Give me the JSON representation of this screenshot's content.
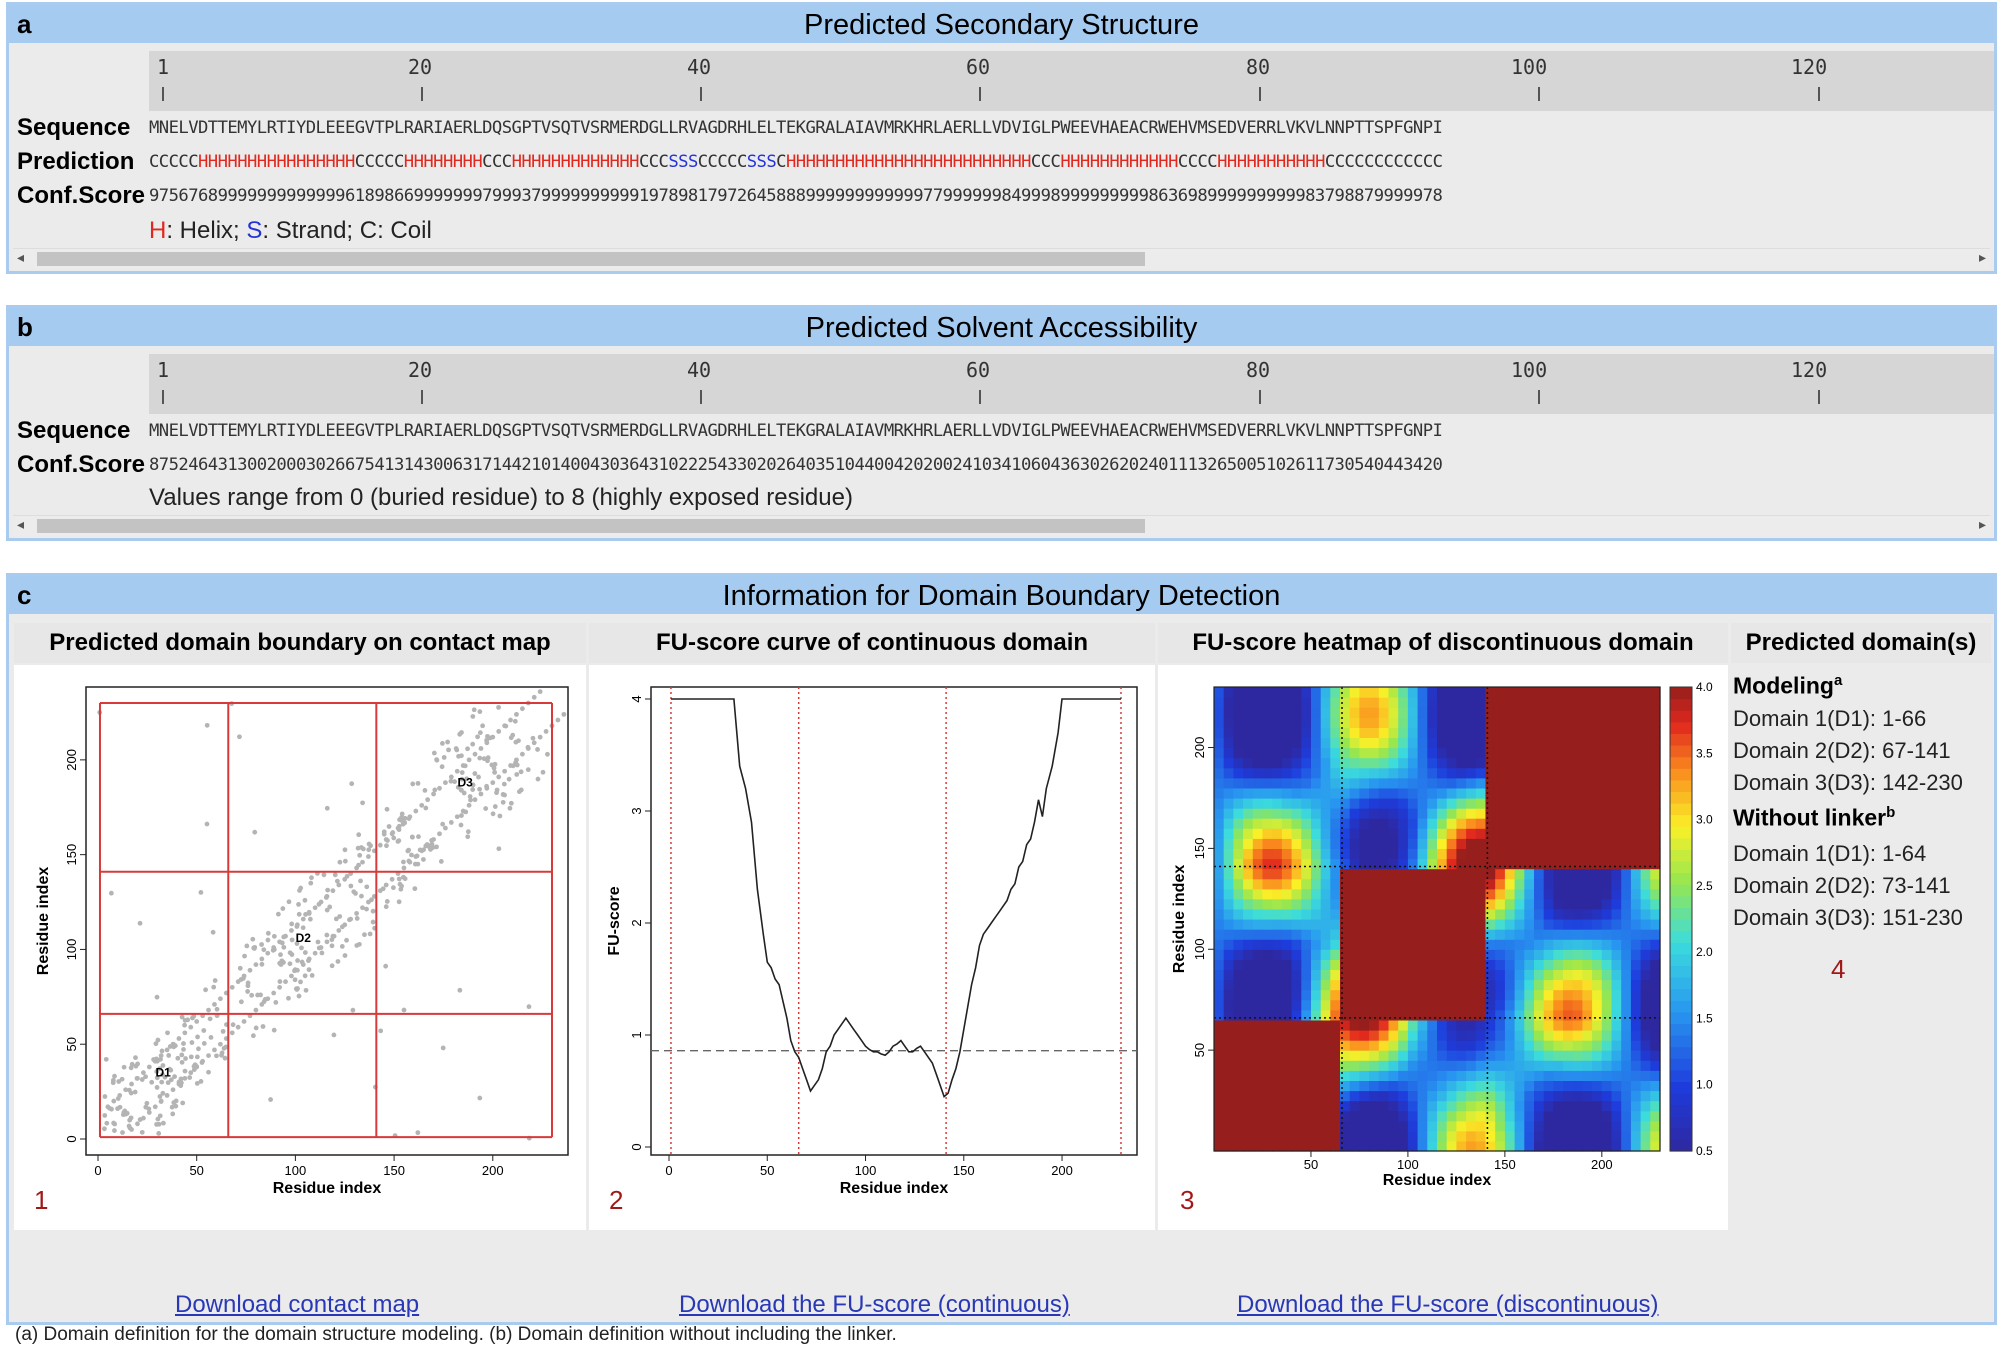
{
  "panel_a": {
    "letter": "a",
    "title": "Predicted Secondary Structure",
    "ticks": [
      "1",
      "20",
      "40",
      "60",
      "80",
      "100",
      "120"
    ],
    "sequence_label": "Sequence",
    "prediction_label": "Prediction",
    "conf_label": "Conf.Score",
    "sequence": "MNELVDTTEMYLRTIYDLEEEGVTPLRARIAERLDQSGPTVSQTVSRMERDGLLRVAGDRHLELTEKGRALAIAVMRKHRLAERLLVDVIGLPWEEVHAEACRWEHVMSEDVERRLVKVLNNPTTSPFGNPI",
    "prediction": "CCCCCHHHHHHHHHHHHHHHHCCCCCHHHHHHHHCCCHHHHHHHHHHHHHCCCSSSCCCCCSSSCHHHHHHHHHHHHHHHHHHHHHHHHHCCCHHHHHHHHHHHHCCCCHHHHHHHHHHHCCCCCCCCCCCC",
    "conf": "975676899999999999996189866999999979993799999999991978981797264588899999999999977999999849998999999999863698999999999983798879999978",
    "legend_h": "H",
    "legend_h_text": ": Helix; ",
    "legend_s": "S",
    "legend_s_text": ": Strand; C: Coil"
  },
  "panel_b": {
    "letter": "b",
    "title": "Predicted Solvent Accessibility",
    "ticks": [
      "1",
      "20",
      "40",
      "60",
      "80",
      "100",
      "120"
    ],
    "sequence_label": "Sequence",
    "conf_label": "Conf.Score",
    "sequence": "MNELVDTTEMYLRTIYDLEEEGVTPLRARIAERLDQSGPTVSQTVSRMERDGLLRVAGDRHLELTEKGRALAIAVMRKHRLAERLLVDVIGLPWEEVHAEACRWEHVMSEDVERRLVKVLNNPTTSPFGNPI",
    "conf": "875246431300200030266754131430063171442101400430364310222543302026403510440042020024103410604363026202401113265005102611730540443420",
    "legend": "Values range from 0 (buried residue) to 8 (highly exposed residue)"
  },
  "panel_c": {
    "letter": "c",
    "title": "Information for Domain Boundary Detection",
    "col1_title": "Predicted domain boundary on contact map",
    "col2_title": "FU-score curve of continuous domain",
    "col3_title": "FU-score heatmap of discontinuous domain",
    "col4_title": "Predicted domain(s)",
    "fig_nums": [
      "1",
      "2",
      "3",
      "4"
    ],
    "modeling_label": "Modeling",
    "modeling_sup": "a",
    "modeling_domains": [
      "Domain 1(D1): 1-66",
      "Domain 2(D2): 67-141",
      "Domain 3(D3): 142-230"
    ],
    "linker_label": "Without linker",
    "linker_sup": "b",
    "linker_domains": [
      "Domain 1(D1): 1-64",
      "Domain 2(D2): 73-141",
      "Domain 3(D3): 151-230"
    ],
    "links": [
      "Download contact map",
      "Download the FU-score (continuous)",
      "Download the FU-score (discontinuous)"
    ],
    "footnote": "(a) Domain definition for the domain structure modeling. (b) Domain definition without including the linker."
  },
  "chart_data": [
    {
      "type": "scatter",
      "xlabel": "Residue index",
      "ylabel": "Residue index",
      "xticks": [
        "0",
        "50",
        "100",
        "150",
        "200"
      ],
      "yticks": [
        "0",
        "50",
        "100",
        "150",
        "200"
      ],
      "xlim": [
        0,
        230
      ],
      "ylim": [
        0,
        230
      ],
      "boundaries": [
        1,
        66,
        141,
        230
      ],
      "labels": [
        {
          "text": "D1",
          "x": 33,
          "y": 33
        },
        {
          "text": "D2",
          "x": 104,
          "y": 104
        },
        {
          "text": "D3",
          "x": 186,
          "y": 186
        }
      ]
    },
    {
      "type": "line",
      "xlabel": "Residue index",
      "ylabel": "FU-score",
      "xticks": [
        "0",
        "50",
        "100",
        "150",
        "200"
      ],
      "yticks": [
        "0",
        "1",
        "2",
        "3",
        "4"
      ],
      "xlim": [
        0,
        230
      ],
      "ylim": [
        0,
        4
      ],
      "threshold": 0.86,
      "vlines": [
        1,
        66,
        141,
        230
      ],
      "x": [
        1,
        33,
        36,
        39,
        42,
        45,
        48,
        50,
        52,
        54,
        56,
        58,
        60,
        62,
        64,
        66,
        68,
        70,
        72,
        74,
        76,
        78,
        80,
        82,
        84,
        86,
        88,
        90,
        92,
        94,
        96,
        98,
        100,
        102,
        104,
        106,
        108,
        110,
        112,
        114,
        116,
        118,
        120,
        122,
        124,
        126,
        128,
        130,
        132,
        134,
        136,
        138,
        140,
        142,
        144,
        146,
        148,
        150,
        152,
        154,
        156,
        158,
        160,
        162,
        164,
        166,
        168,
        170,
        172,
        174,
        176,
        178,
        180,
        182,
        184,
        186,
        188,
        190,
        192,
        195,
        198,
        200,
        230
      ],
      "y": [
        4.0,
        4.0,
        3.4,
        3.2,
        2.9,
        2.3,
        1.9,
        1.65,
        1.6,
        1.5,
        1.45,
        1.3,
        1.15,
        0.95,
        0.85,
        0.8,
        0.7,
        0.6,
        0.5,
        0.55,
        0.6,
        0.7,
        0.85,
        0.9,
        1.0,
        1.05,
        1.1,
        1.15,
        1.1,
        1.05,
        1.0,
        0.95,
        0.9,
        0.87,
        0.85,
        0.85,
        0.83,
        0.82,
        0.85,
        0.9,
        0.92,
        0.95,
        0.9,
        0.85,
        0.85,
        0.88,
        0.9,
        0.85,
        0.8,
        0.75,
        0.65,
        0.55,
        0.45,
        0.48,
        0.6,
        0.7,
        0.85,
        1.05,
        1.25,
        1.45,
        1.6,
        1.8,
        1.9,
        1.95,
        2.0,
        2.05,
        2.1,
        2.15,
        2.2,
        2.3,
        2.35,
        2.5,
        2.55,
        2.7,
        2.75,
        2.9,
        3.1,
        2.95,
        3.2,
        3.4,
        3.7,
        4.0,
        4.0
      ]
    },
    {
      "type": "heatmap",
      "xlabel": "Residue index",
      "ylabel": "Residue index",
      "xticks": [
        "50",
        "100",
        "150",
        "200"
      ],
      "yticks": [
        "50",
        "100",
        "150",
        "200"
      ],
      "xlim": [
        0,
        230
      ],
      "ylim": [
        0,
        230
      ],
      "colorbar_ticks": [
        "0.5",
        "1.0",
        "1.5",
        "2.0",
        "2.5",
        "3.0",
        "3.5",
        "4.0"
      ],
      "colorbar_range": [
        0.5,
        4.0
      ],
      "dotted_lines": [
        66,
        141
      ]
    }
  ]
}
